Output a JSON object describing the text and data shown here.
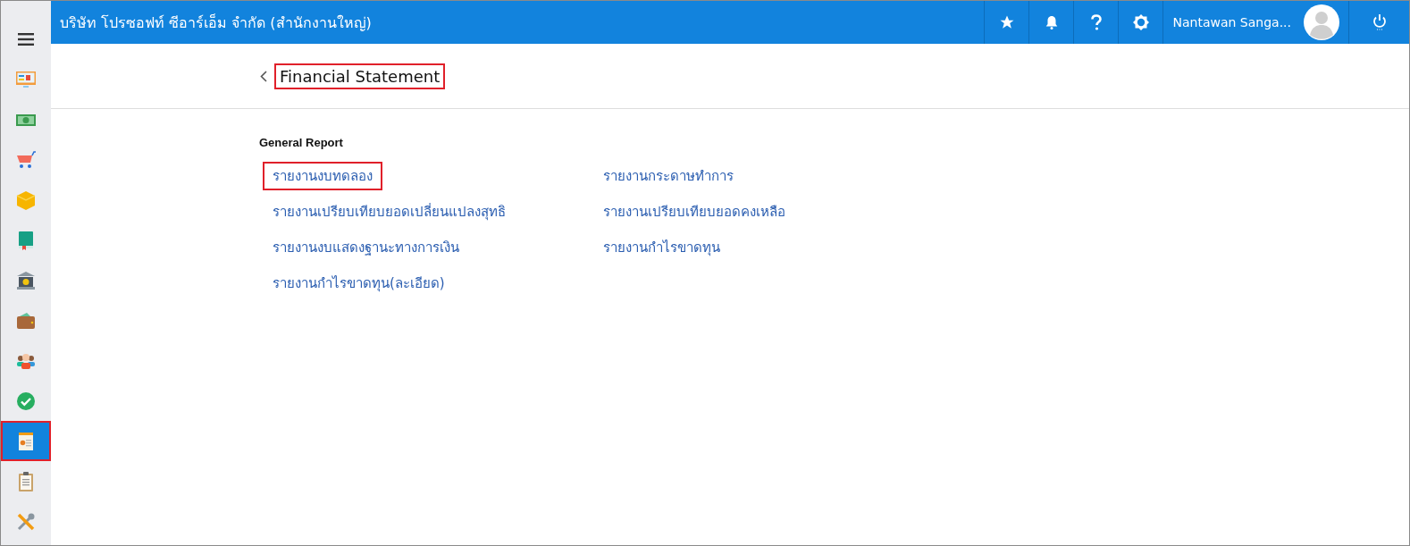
{
  "topbar": {
    "company": "บริษัท โปรซอฟท์ ซีอาร์เอ็ม จำกัด (สำนักงานใหญ่)",
    "user_name": "Nantawan Sanga..."
  },
  "sidebar": {
    "items": [
      {
        "kind": "monitor",
        "selected": false,
        "highlighted": false
      },
      {
        "kind": "money",
        "selected": false,
        "highlighted": false
      },
      {
        "kind": "cart",
        "selected": false,
        "highlighted": false
      },
      {
        "kind": "box",
        "selected": false,
        "highlighted": false
      },
      {
        "kind": "book",
        "selected": false,
        "highlighted": false
      },
      {
        "kind": "bank",
        "selected": false,
        "highlighted": false
      },
      {
        "kind": "wallet",
        "selected": false,
        "highlighted": false
      },
      {
        "kind": "people",
        "selected": false,
        "highlighted": false
      },
      {
        "kind": "check",
        "selected": false,
        "highlighted": false
      },
      {
        "kind": "report",
        "selected": true,
        "highlighted": true
      },
      {
        "kind": "clipboard",
        "selected": false,
        "highlighted": false
      },
      {
        "kind": "tools",
        "selected": false,
        "highlighted": false
      }
    ]
  },
  "page": {
    "title": "Financial Statement",
    "title_highlighted": true
  },
  "section": {
    "heading": "General Report",
    "links": [
      {
        "label": "รายงานงบทดลอง",
        "highlighted": true
      },
      {
        "label": "รายงานกระดาษทำการ",
        "highlighted": false
      },
      {
        "label": "รายงานเปรียบเทียบยอดเปลี่ยนแปลงสุทธิ",
        "highlighted": false
      },
      {
        "label": "รายงานเปรียบเทียบยอดคงเหลือ",
        "highlighted": false
      },
      {
        "label": "รายงานงบแสดงฐานะทางการเงิน",
        "highlighted": false
      },
      {
        "label": "รายงานกำไรขาดทุน",
        "highlighted": false
      },
      {
        "label": "รายงานกำไรขาดทุน(ละเอียด)",
        "highlighted": false
      }
    ]
  }
}
